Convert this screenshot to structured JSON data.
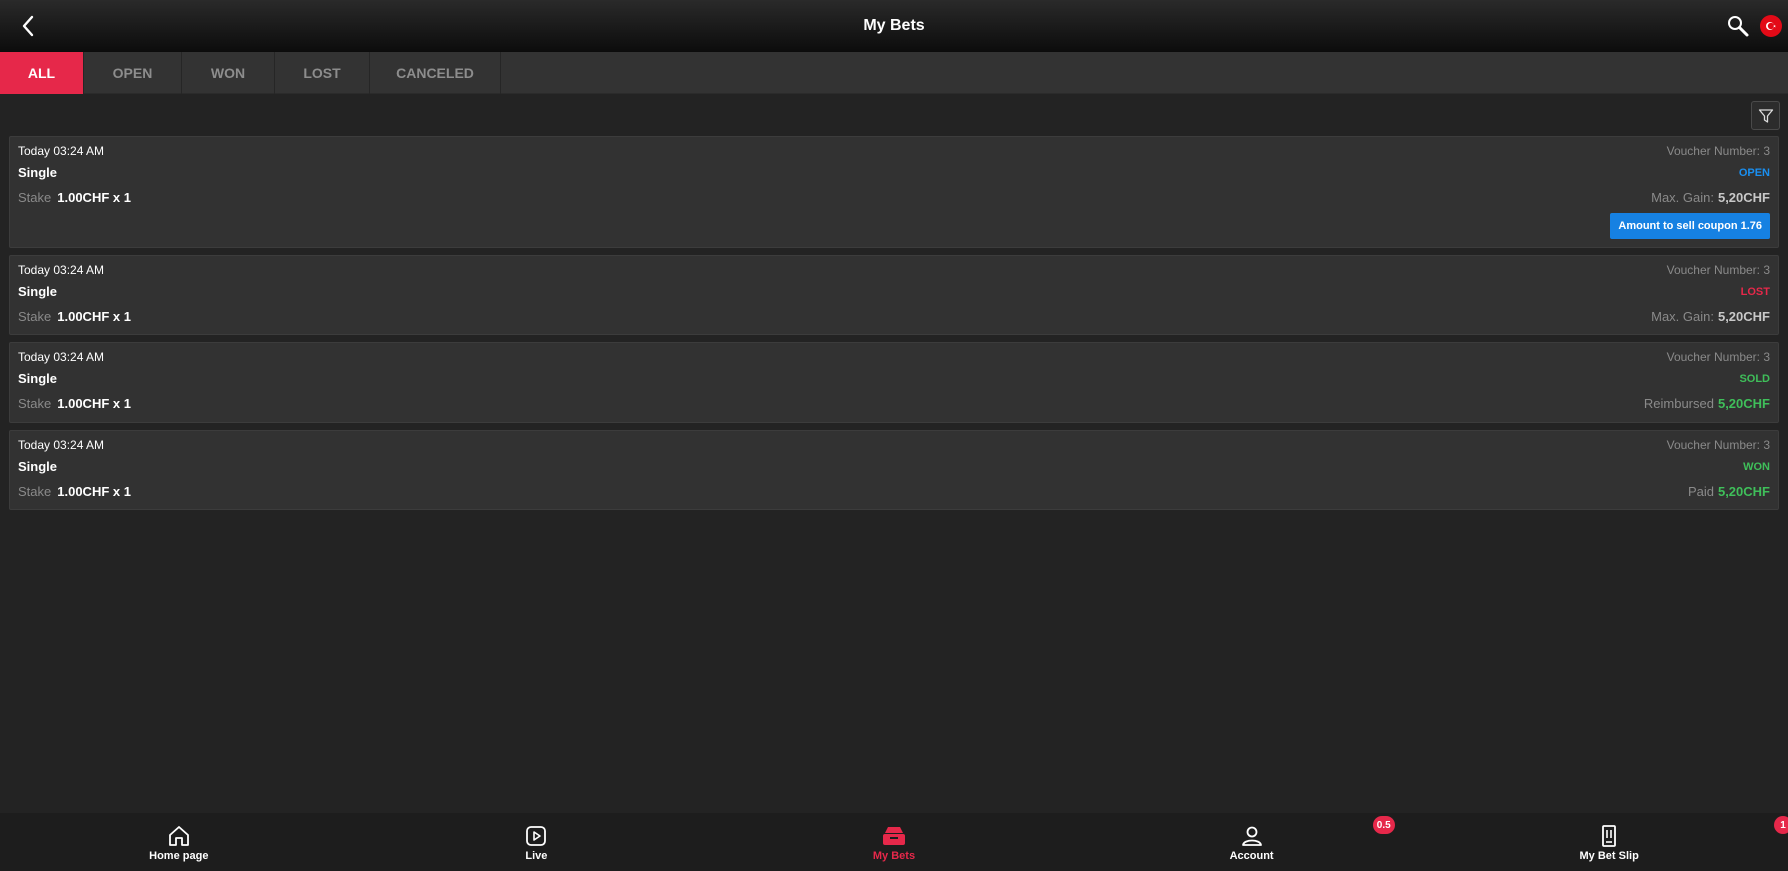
{
  "header": {
    "title": "My Bets",
    "back_icon": "chevron-left-icon",
    "search_icon": "search-icon",
    "flag_icon": "turkey-flag-icon"
  },
  "tabs": [
    {
      "label": "ALL",
      "active": true
    },
    {
      "label": "OPEN",
      "active": false
    },
    {
      "label": "WON",
      "active": false
    },
    {
      "label": "LOST",
      "active": false
    },
    {
      "label": "CANCELED",
      "active": false
    }
  ],
  "filter_icon": "filter-icon",
  "colors": {
    "accent": "#e6284a",
    "open": "#1a8ff0",
    "green": "#3fbf5a",
    "button_blue": "#1681e2"
  },
  "bets": [
    {
      "date": "Today 03:24 AM",
      "type": "Single",
      "stake_label": "Stake",
      "stake_value": "1.00CHF x 1",
      "voucher": "Voucher Number: 3",
      "status": "OPEN",
      "gain_label": "Max. Gain:",
      "gain_value": "5,20CHF",
      "sell_button": "Amount to sell coupon 1.76"
    },
    {
      "date": "Today 03:24 AM",
      "type": "Single",
      "stake_label": "Stake",
      "stake_value": "1.00CHF x 1",
      "voucher": "Voucher Number: 3",
      "status": "LOST",
      "gain_label": "Max. Gain:",
      "gain_value": "5,20CHF"
    },
    {
      "date": "Today 03:24 AM",
      "type": "Single",
      "stake_label": "Stake",
      "stake_value": "1.00CHF x 1",
      "voucher": "Voucher Number: 3",
      "status": "SOLD",
      "gain_label": "Reimbursed",
      "gain_value": "5,20CHF"
    },
    {
      "date": "Today 03:24 AM",
      "type": "Single",
      "stake_label": "Stake",
      "stake_value": "1.00CHF x 1",
      "voucher": "Voucher Number: 3",
      "status": "WON",
      "gain_label": "Paid",
      "gain_value": "5,20CHF"
    }
  ],
  "nav": [
    {
      "label": "Home page",
      "icon": "home-icon"
    },
    {
      "label": "Live",
      "icon": "play-icon"
    },
    {
      "label": "My Bets",
      "icon": "my-bets-icon",
      "active": true
    },
    {
      "label": "Account",
      "icon": "user-icon",
      "badge": "0.5"
    },
    {
      "label": "My Bet Slip",
      "icon": "bet-slip-icon",
      "badge": "1"
    }
  ]
}
